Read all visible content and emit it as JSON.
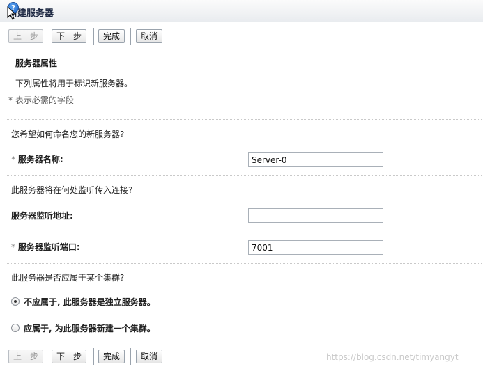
{
  "window": {
    "title": "新建服务器"
  },
  "toolbar": {
    "back": "上一步",
    "next": "下一步",
    "finish": "完成",
    "cancel": "取消"
  },
  "section": {
    "title": "服务器属性",
    "description": "下列属性将用于标识新服务器。",
    "required_note": "* 表示必需的字段"
  },
  "questions": {
    "name_question": "您希望如何命名您的新服务器?",
    "listen_question": "此服务器将在何处监听传入连接?",
    "cluster_question": "此服务器是否应属于某个集群?"
  },
  "fields": {
    "server_name": {
      "label": "服务器名称:",
      "value": "Server-0",
      "required": true
    },
    "listen_address": {
      "label": "服务器监听地址:",
      "value": "",
      "required": false
    },
    "listen_port": {
      "label": "服务器监听端口:",
      "value": "7001",
      "required": true
    }
  },
  "required_marker": "*",
  "cluster_options": [
    {
      "label": "不应属于, 此服务器是独立服务器。",
      "selected": true
    },
    {
      "label": "应属于, 为此服务器新建一个集群。",
      "selected": false
    }
  ],
  "watermark": "https://blog.csdn.net/timyangyt",
  "icons": {
    "help": "help-badge-icon",
    "cursor": "mouse-pointer-icon"
  }
}
